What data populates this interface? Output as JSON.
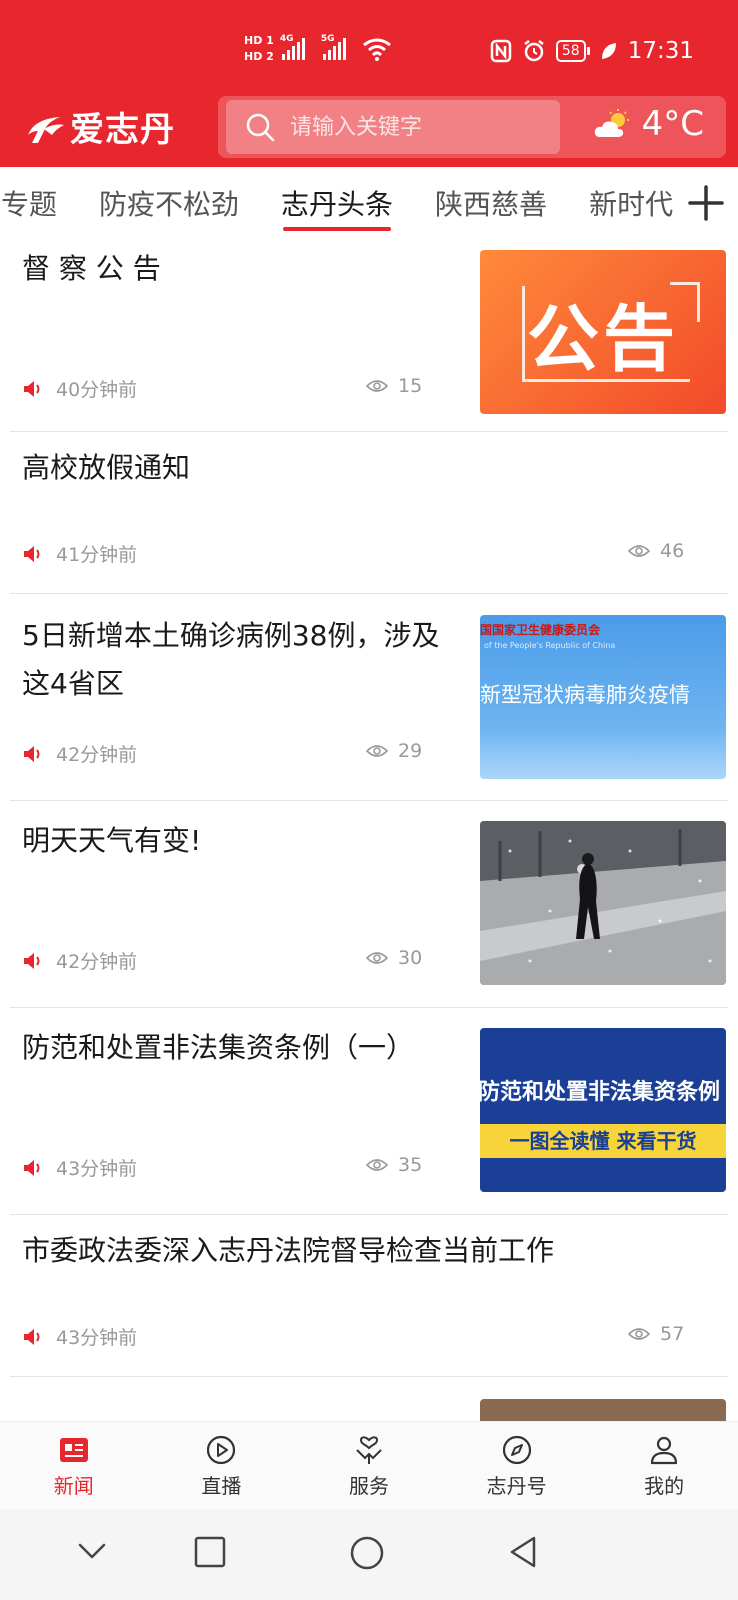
{
  "status_bar": {
    "hd1": "HD 1",
    "hd2": "HD 2",
    "net1": "4G",
    "net2": "5G",
    "battery": "58",
    "time": "17:31"
  },
  "header": {
    "logo_text": "爱志丹",
    "search_placeholder": "请输入关键字",
    "weather_icon": "partly-cloudy-icon",
    "temperature": "4°C"
  },
  "tabs": [
    "专题",
    "防疫不松劲",
    "志丹头条",
    "陕西慈善",
    "新时代"
  ],
  "active_tab": "志丹头条",
  "feed": [
    {
      "title": "督 察 公 告",
      "time": "40分钟前",
      "views": "15",
      "thumb_text": "公告"
    },
    {
      "title": "高校放假通知",
      "time": "41分钟前",
      "views": "46"
    },
    {
      "title": "5日新增本土确诊病例38例，涉及这4省区",
      "time": "42分钟前",
      "views": "29",
      "thumb_header": "国国家卫生健康委员会",
      "thumb_sub": "of the People's Republic of China",
      "thumb_text": "新型冠状病毒肺炎疫情"
    },
    {
      "title": "明天天气有变!",
      "time": "42分钟前",
      "views": "30"
    },
    {
      "title": "防范和处置非法集资条例（一）",
      "time": "43分钟前",
      "views": "35",
      "thumb_text": "防范和处置非法集资条例",
      "thumb_banner": "一图全读懂 来看干货"
    },
    {
      "title": "市委政法委深入志丹法院督导检查当前工作",
      "time": "43分钟前",
      "views": "57"
    }
  ],
  "bottom_nav": [
    "新闻",
    "直播",
    "服务",
    "志丹号",
    "我的"
  ],
  "colors": {
    "brand": "#e8262e",
    "meta": "#999999"
  }
}
